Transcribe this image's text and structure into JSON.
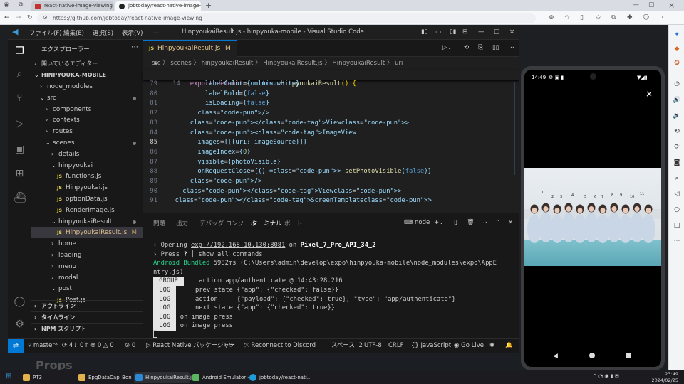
{
  "browser": {
    "tabs": [
      {
        "title": "react-native-image-viewing - np"
      },
      {
        "title": "jobtoday/react-native-image-vie"
      }
    ],
    "new_tab": "+",
    "url": "https://github.com/jobtoday/react-native-image-viewing"
  },
  "vscode": {
    "menus": [
      "ファイル(F)",
      "編集(E)",
      "選択(S)",
      "表示(V)",
      "…"
    ],
    "title": "HinpyoukaiResult.js - hinpyouka-mobile - Visual Studio Code",
    "explorer_title": "エクスプローラー",
    "open_editors": "開いているエディター",
    "project": "HINPYOUKA-MOBILE",
    "tree": [
      {
        "label": "node_modules",
        "type": "folder-closed",
        "indent": 1
      },
      {
        "label": "src",
        "type": "folder-open",
        "indent": 1,
        "dot": true
      },
      {
        "label": "components",
        "type": "folder-closed",
        "indent": 2
      },
      {
        "label": "contexts",
        "type": "folder-closed",
        "indent": 2
      },
      {
        "label": "routes",
        "type": "folder-closed",
        "indent": 2
      },
      {
        "label": "scenes",
        "type": "folder-open",
        "indent": 2,
        "dot": true
      },
      {
        "label": "details",
        "type": "folder-closed",
        "indent": 3
      },
      {
        "label": "hinpyoukai",
        "type": "folder-open",
        "indent": 3
      },
      {
        "label": "functions.js",
        "type": "file",
        "indent": 4
      },
      {
        "label": "Hinpyoukai.js",
        "type": "file",
        "indent": 4
      },
      {
        "label": "optionData.js",
        "type": "file",
        "indent": 4
      },
      {
        "label": "RenderImage.js",
        "type": "file",
        "indent": 4
      },
      {
        "label": "hinpyoukaiResult",
        "type": "folder-open",
        "indent": 3,
        "dot": true
      },
      {
        "label": "HinpyoukaiResult.js",
        "type": "file",
        "indent": 4,
        "selected": true,
        "mark": "M"
      },
      {
        "label": "home",
        "type": "folder-closed",
        "indent": 3
      },
      {
        "label": "loading",
        "type": "folder-closed",
        "indent": 3
      },
      {
        "label": "menu",
        "type": "folder-closed",
        "indent": 3
      },
      {
        "label": "modal",
        "type": "folder-closed",
        "indent": 3
      },
      {
        "label": "post",
        "type": "folder-open",
        "indent": 3
      },
      {
        "label": "Post.js",
        "type": "file",
        "indent": 4
      }
    ],
    "outline": "アウトライン",
    "timeline": "タイムライン",
    "npm_scripts": "NPM スクリプト",
    "editor_tab": {
      "name": "HinpyoukaiResult.js",
      "mark": "M",
      "close": "×"
    },
    "breadcrumbs": "src 〉 scenes 〉 hinpyoukaiResult 〉 HinpyoukaiResult.js 〉 HinpyoukaiResult 〉 uri",
    "sticky_line": {
      "num": "14",
      "text": "export default function HinpyoukaiResult() {"
    },
    "code_lines": [
      {
        "num": "79",
        "text": "          labelColor={colors.white}"
      },
      {
        "num": "80",
        "text": "          labelBold={false}"
      },
      {
        "num": "81",
        "text": "          isLoading={false}"
      },
      {
        "num": "82",
        "text": "        />"
      },
      {
        "num": "83",
        "text": "      </View>"
      },
      {
        "num": "84",
        "text": "      <ImageView"
      },
      {
        "num": "85",
        "text": "        images={[{uri: imageSource}]}"
      },
      {
        "num": "86",
        "text": "        imageIndex={0}"
      },
      {
        "num": "87",
        "text": "        visible={photoVisible}"
      },
      {
        "num": "88",
        "text": "        onRequestClose={() => setPhotoVisible(false)}"
      },
      {
        "num": "89",
        "text": "      />"
      },
      {
        "num": "90",
        "text": "    </View>"
      },
      {
        "num": "91",
        "text": "  </ScreenTemplate>"
      }
    ],
    "panel_tabs": [
      "問題",
      "出力",
      "デバッグ コンソール",
      "ターミナル",
      "ポート"
    ],
    "terminal_name": "node",
    "terminal": {
      "opening_prefix": "› Opening ",
      "opening_url": "exp://192.168.10.130:8081",
      "opening_on": " on ",
      "opening_device": "Pixel_7_Pro_API_34_2",
      "press_prefix": "› Press ",
      "press_key": "?",
      "press_suffix": " │ show all commands",
      "bundled_label": "Android Bundled",
      "bundled_rest": " 5982ms (C:\\Users\\admin\\develop\\expo\\hinpyouka-mobile\\node_modules\\expo\\AppE",
      "bundled_cont": "ntry.js)",
      "group_badge": " GROUP ",
      "group_text": "    action app/authenticate @ 14:43:28.216",
      "log_badge": " LOG ",
      "log1": "     prev state {\"app\": {\"checked\": false}}",
      "log2": "     action     {\"payload\": {\"checked\": true}, \"type\": \"app/authenticate\"}",
      "log3": "     next state {\"app\": {\"checked\": true}}",
      "log4": " on image press",
      "log5": " on image press"
    },
    "status": {
      "branch": "master*",
      "sync": "4↓ 0↑",
      "errors": "0",
      "warnings": "0",
      "ports": "0",
      "react_native": "React Native パッケージャー",
      "discord": "Reconnect to Discord",
      "spaces": "スペース: 2",
      "encoding": "UTF-8",
      "eol": "CRLF",
      "language": "JavaScript",
      "golive": "Go Live"
    }
  },
  "emulator": {
    "time": "14:49",
    "photo_numbers": [
      "1",
      "2",
      "3",
      "4",
      "5",
      "6",
      "7",
      "8",
      "9",
      "10",
      "11"
    ]
  },
  "below_text": "Props",
  "taskbar": {
    "items": [
      "PT3",
      "EpgDataCap_Bon",
      "HinpyoukaiResult.j...",
      "Android Emulator -...",
      "jobtoday/react-nati..."
    ],
    "time": "23:49",
    "date": "2024/02/25"
  },
  "colors": {
    "accent": "#0078d4",
    "editor_bg": "#1f1f1f",
    "sidebar_bg": "#181818"
  }
}
